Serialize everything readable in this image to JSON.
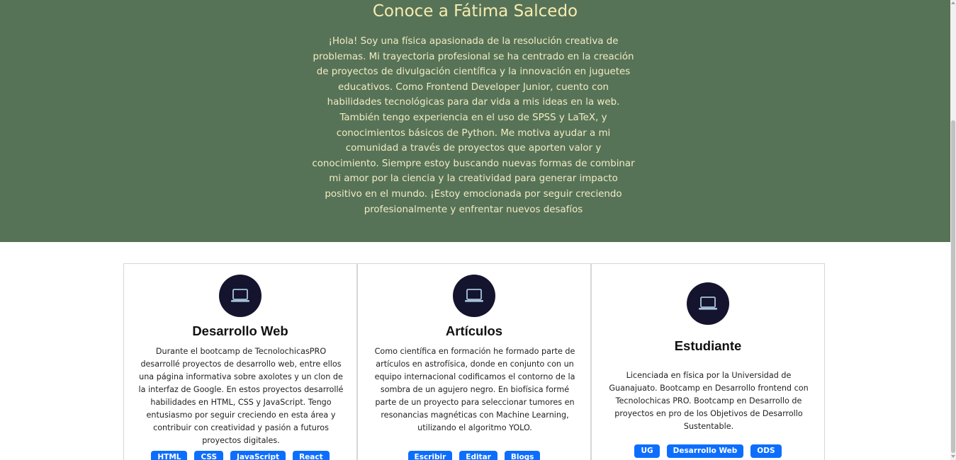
{
  "hero": {
    "title": "Conoce a Fátima Salcedo",
    "bio": "¡Hola! Soy una física apasionada de la resolución creativa de problemas. Mi trayectoria profesional se ha centrado en la creación de proyectos de divulgación científica y la innovación en juguetes educativos. Como Frontend Developer Junior, cuento con habilidades tecnológicas para dar vida a mis ideas en la web. También tengo experiencia en el uso de SPSS y LaTeX, y conocimientos básicos de Python. Me motiva ayudar a mi comunidad a través de proyectos que aporten valor y conocimiento. Siempre estoy buscando nuevas formas de combinar mi amor por la ciencia y la creatividad para generar impacto positivo en el mundo. ¡Estoy emocionada por seguir creciendo profesionalmente y enfrentar nuevos desafíos",
    "background": "#577357",
    "title_color": "#f5ecb0"
  },
  "cards": [
    {
      "icon": "laptop-icon",
      "title": "Desarrollo Web",
      "text": "Durante el bootcamp de TecnolochicasPRO desarrollé proyectos de desarrollo web, entre ellos una página informativa sobre axolotes y un clon de la interfaz de Google. En estos proyectos desarrollé habilidades en HTML, CSS y JavaScript. Tengo entusiasmo por seguir creciendo en esta área y contribuir con creatividad y pasión a futuros proyectos digitales.",
      "badges": [
        "HTML",
        "CSS",
        "JavaScript",
        "React"
      ]
    },
    {
      "icon": "laptop-icon",
      "title": "Artículos",
      "text": "Como científica en formación he formado parte de artículos en astrofísica, donde en conjunto con un equipo internacional codificamos el contorno de la sombra de un agujero negro. En biofísica formé parte de un proyecto para seleccionar tumores en resonancias magnéticas con Machine Learning, utilizando el algoritmo YOLO.",
      "badges": [
        "Escribir",
        "Editar",
        "Blogs"
      ]
    },
    {
      "icon": "laptop-icon",
      "title": "Estudiante",
      "text": "Licenciada en física por la Universidad de Guanajuato. Bootcamp en Desarrollo frontend con Tecnolochicas PRO. Bootcamp en Desarrollo de proyectos en pro de los Objetivos de Desarrollo Sustentable.",
      "badges": [
        "UG",
        "Desarrollo Web",
        "ODS"
      ]
    }
  ],
  "colors": {
    "icon_circle": "#14142e",
    "badge": "#0d6efd"
  }
}
